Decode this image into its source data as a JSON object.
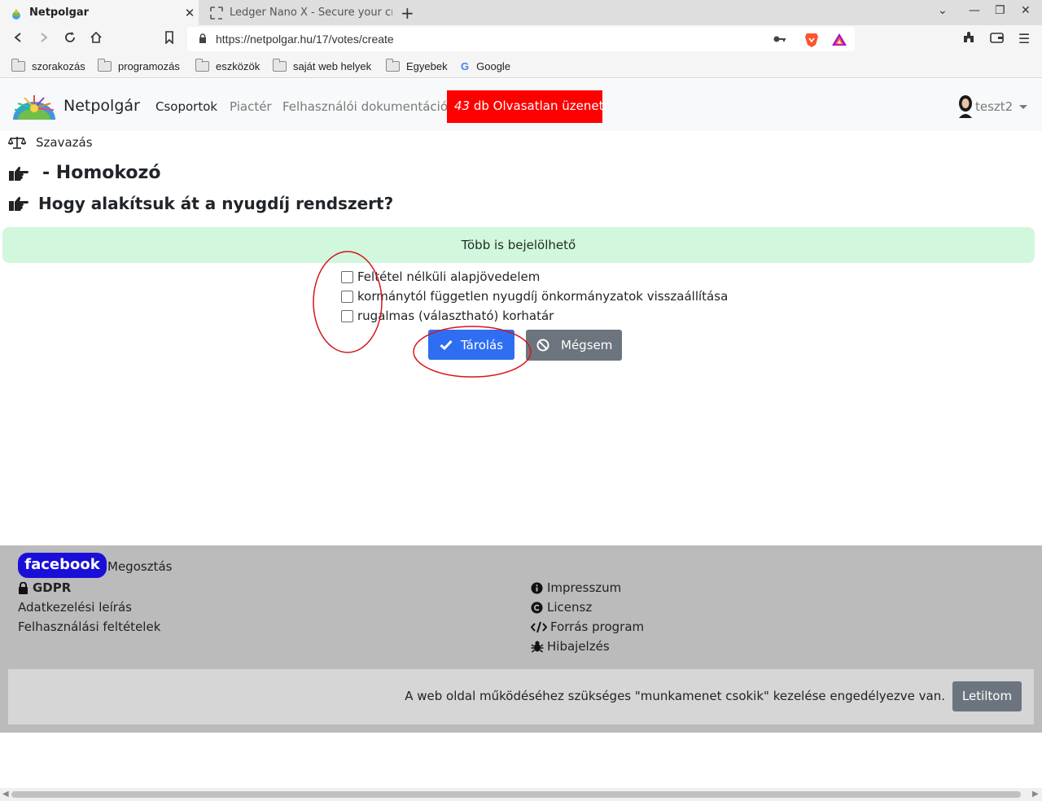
{
  "browser": {
    "tabs": [
      {
        "title": "Netpolgar",
        "active": true
      },
      {
        "title": "Ledger Nano X - Secure your crypto",
        "active": false
      }
    ],
    "url": "https://netpolgar.hu/17/votes/create",
    "bookmarks": [
      "szorakozás",
      "programozás",
      "eszközök",
      "saját web helyek",
      "Egyebek",
      "Google"
    ]
  },
  "site": {
    "brand": "Netpolgár",
    "nav": [
      "Csoportok",
      "Piactér",
      "Felhasználói dokumentáció"
    ],
    "unread_count": "43",
    "unread_text": "db Olvasatlan üzenet",
    "user": "teszt2"
  },
  "page": {
    "breadcrumb": "Szavazás",
    "group_title": "- Homokozó",
    "question": "Hogy alakítsuk át a nyugdíj rendszert?",
    "alert": "Több is bejelölhető",
    "options": [
      "Feltétel nélküli alapjövedelem",
      "kormánytól független nyugdíj önkormányzatok visszaállítása",
      "rugalmas (választható) korhatár"
    ],
    "save_label": "Tárolás",
    "cancel_label": "Mégsem"
  },
  "footer": {
    "facebook": "facebook",
    "share": "Megosztás",
    "gdpr": "GDPR",
    "left_links": [
      "Adatkezelési leírás",
      "Felhasználási feltételek"
    ],
    "right_links": [
      "Impresszum",
      "Licensz",
      "Forrás program",
      "Hibajelzés"
    ],
    "cookie_text": "A web oldal működéséhez szükséges \"munkamenet csokik\" kezelése engedélyezve van.",
    "deny_label": "Letiltom"
  },
  "colors": {
    "unread_bg": "#ff0000",
    "alert_bg": "#d1f7dc",
    "primary": "#2f6ef2",
    "secondary": "#6c757d",
    "facebook": "#1a0fd9",
    "annotation": "#d9141c"
  }
}
